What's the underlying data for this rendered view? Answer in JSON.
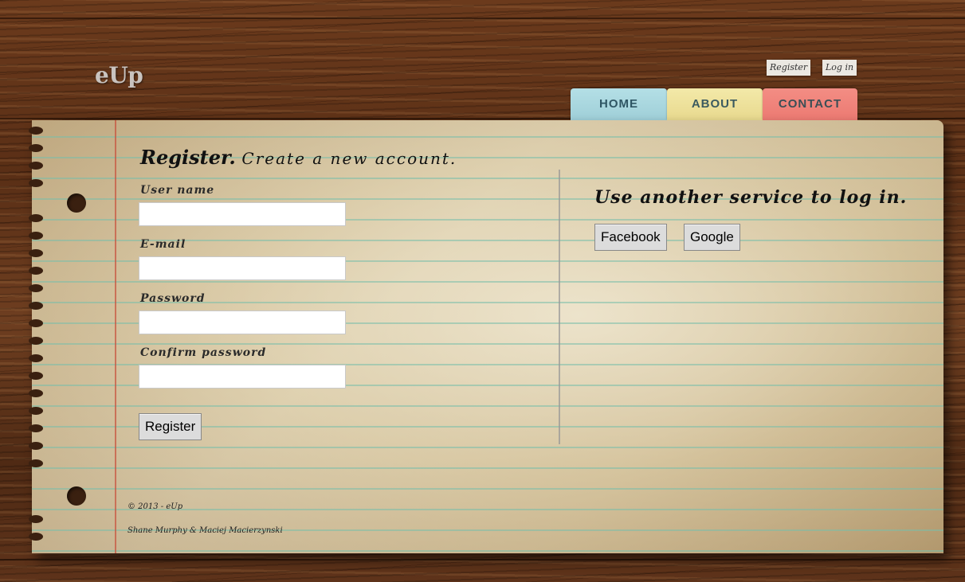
{
  "site": {
    "logo": "eUp"
  },
  "top_links": {
    "register": "Register",
    "login": "Log in"
  },
  "nav": {
    "tabs": [
      {
        "label": "HOME",
        "color": "#a8d8e0"
      },
      {
        "label": "ABOUT",
        "color": "#eee09a"
      },
      {
        "label": "CONTACT",
        "color": "#ef837b"
      }
    ]
  },
  "form": {
    "title_strong": "Register.",
    "title_sub": "Create a new account.",
    "fields": [
      {
        "label": "User name",
        "value": ""
      },
      {
        "label": "E-mail",
        "value": ""
      },
      {
        "label": "Password",
        "value": ""
      },
      {
        "label": "Confirm password",
        "value": ""
      }
    ],
    "submit_label": "Register"
  },
  "external": {
    "title": "Use another service to log in.",
    "providers": [
      "Facebook",
      "Google"
    ]
  },
  "footer": {
    "copyright": "© 2013 - eUp",
    "authors": "Shane Murphy & Maciej Macierzynski"
  }
}
